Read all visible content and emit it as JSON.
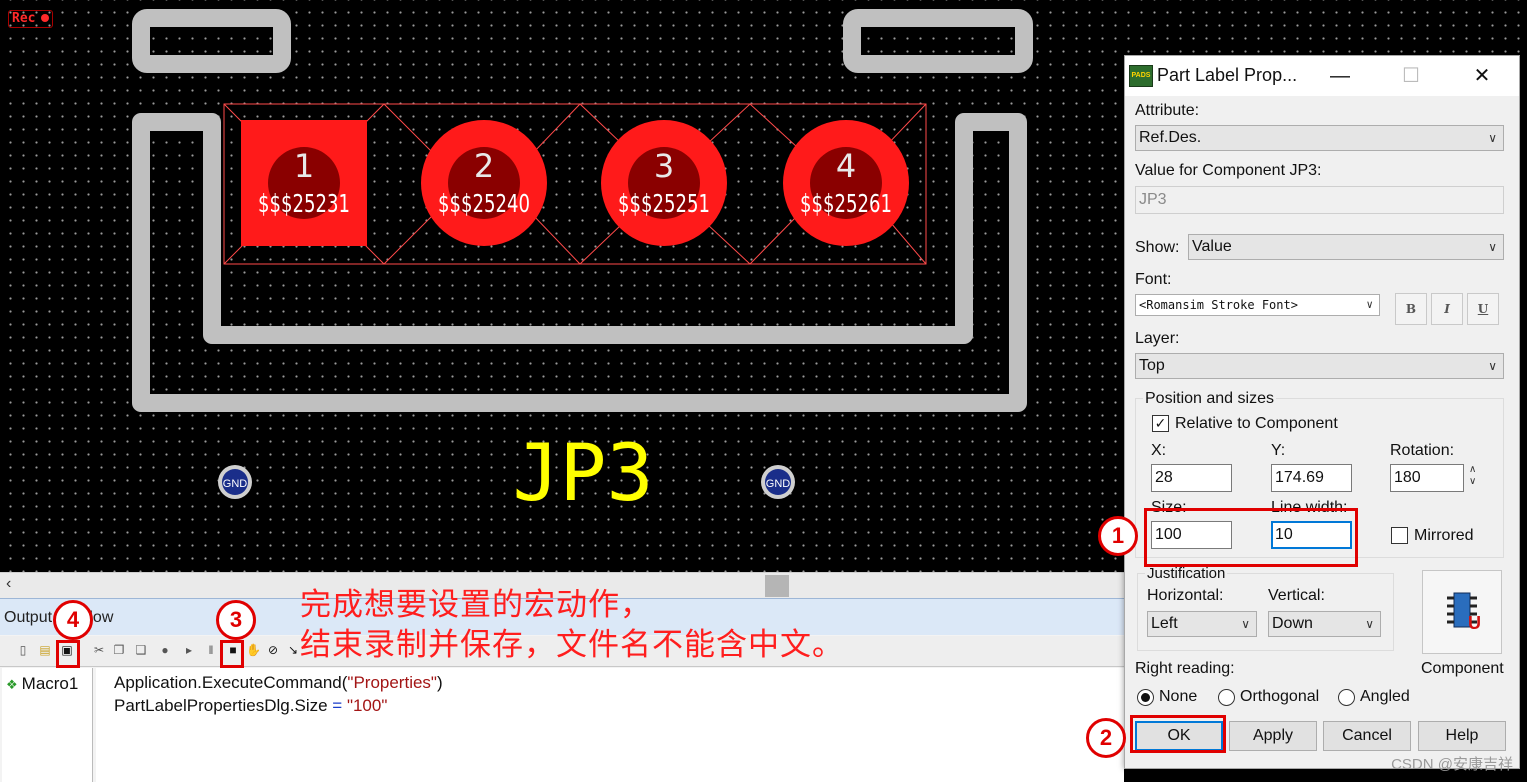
{
  "canvas": {
    "rec_label": "Rec",
    "pads": [
      {
        "number": "1",
        "net": "$$$25231",
        "shape": "square"
      },
      {
        "number": "2",
        "net": "$$$25240",
        "shape": "round"
      },
      {
        "number": "3",
        "net": "$$$25251",
        "shape": "round"
      },
      {
        "number": "4",
        "net": "$$$25261",
        "shape": "round"
      }
    ],
    "component_label": "JP3",
    "via_labels": [
      "GND",
      "GND"
    ],
    "colors": {
      "pad": "#ff1a1a",
      "outline": "#c0c0c0",
      "label": "#ffff00",
      "via": "#1a2e8a"
    }
  },
  "output_window": {
    "title": "Output Window",
    "tree_item": "Macro1",
    "code_lines": [
      {
        "prefix": "Application.ExecuteCommand(",
        "string": "\"Properties\"",
        "suffix": ")"
      },
      {
        "prefix": "PartLabelPropertiesDlg.Size ",
        "op": "=",
        "string": " \"100\""
      }
    ]
  },
  "annotation": {
    "line1": "完成想要设置的宏动作，",
    "line2": "结束录制并保存，文件名不能含中文。"
  },
  "markers": [
    "1",
    "2",
    "3",
    "4"
  ],
  "dialog": {
    "title": "Part Label Prop...",
    "attribute_label": "Attribute:",
    "attribute_value": "Ref.Des.",
    "value_label": "Value for Component JP3:",
    "value_value": "JP3",
    "show_label": "Show:",
    "show_value": "Value",
    "font_label": "Font:",
    "font_value": "<Romansim Stroke Font>",
    "font_buttons": {
      "bold": "B",
      "italic": "I",
      "underline": "U"
    },
    "layer_label": "Layer:",
    "layer_value": "Top",
    "position_group": "Position and sizes",
    "relative_label": "Relative to Component",
    "relative_checked": true,
    "x_label": "X:",
    "x_value": "28",
    "y_label": "Y:",
    "y_value": "174.69",
    "rotation_label": "Rotation:",
    "rotation_value": "180",
    "size_label": "Size:",
    "size_value": "100",
    "linewidth_label": "Line width:",
    "linewidth_value": "10",
    "mirrored_label": "Mirrored",
    "justification_group": "Justification",
    "horizontal_label": "Horizontal:",
    "horizontal_value": "Left",
    "vertical_label": "Vertical:",
    "vertical_value": "Down",
    "component_button": "Component",
    "right_reading_label": "Right reading:",
    "radio_none": "None",
    "radio_orthogonal": "Orthogonal",
    "radio_angled": "Angled",
    "right_reading_selected": "None",
    "buttons": {
      "ok": "OK",
      "apply": "Apply",
      "cancel": "Cancel",
      "help": "Help"
    }
  },
  "watermark": "CSDN @安康吉祥"
}
